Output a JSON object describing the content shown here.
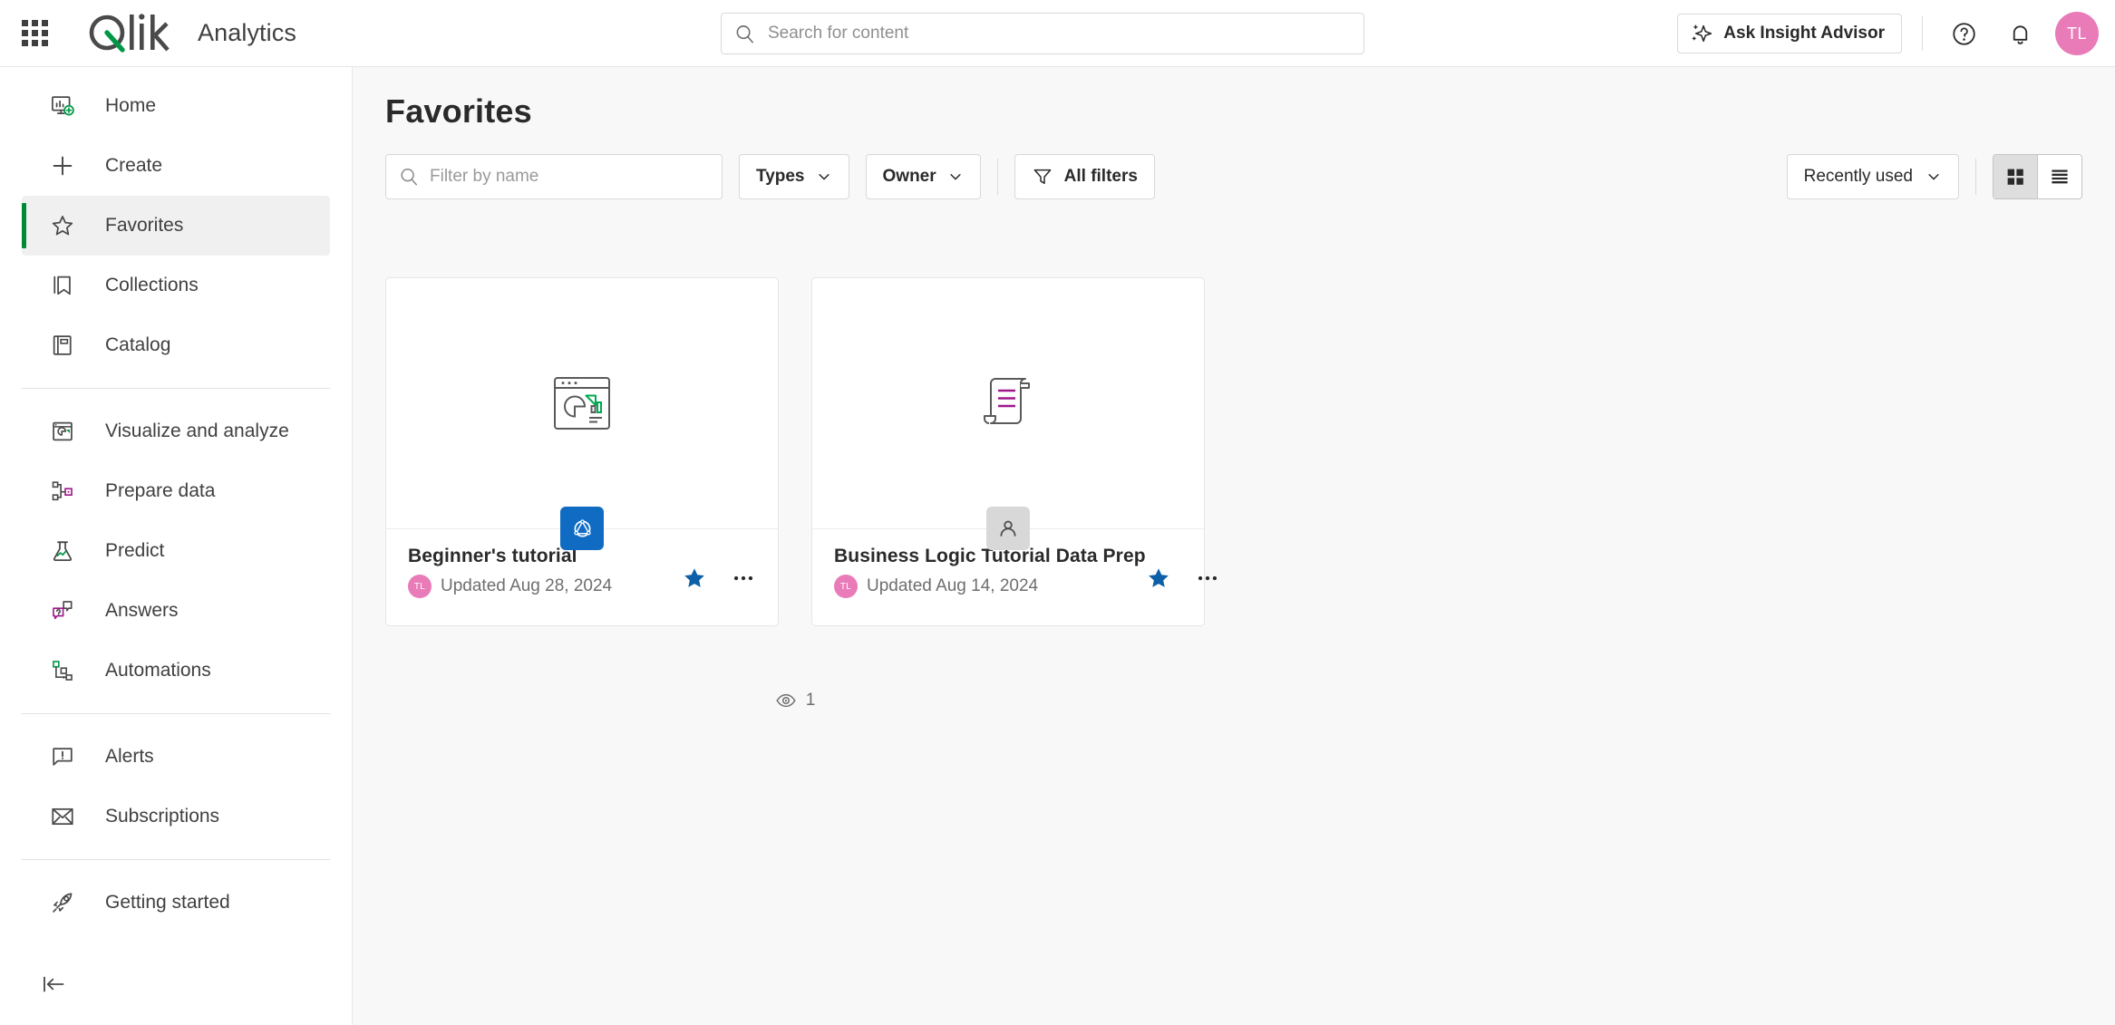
{
  "header": {
    "launcher_icon": "app-launcher-grid-icon",
    "brand": "Qlik",
    "product": "Analytics",
    "search": {
      "placeholder": "Search for content",
      "value": "",
      "icon": "search-icon"
    },
    "insight_advisor_label": "Ask Insight Advisor",
    "insight_icon": "sparkle-icon",
    "help_icon": "help-circle-icon",
    "notifications_icon": "bell-icon",
    "avatar_initials": "TL",
    "avatar_color": "#e87bb8"
  },
  "sidebar": {
    "items": [
      {
        "label": "Home",
        "icon": "home-dashboard-icon",
        "active": false
      },
      {
        "label": "Create",
        "icon": "plus-icon",
        "active": false
      },
      {
        "label": "Favorites",
        "icon": "star-outline-icon",
        "active": true
      },
      {
        "label": "Collections",
        "icon": "bookmark-icon",
        "active": false
      },
      {
        "label": "Catalog",
        "icon": "catalog-book-icon",
        "active": false
      },
      {
        "label": "Visualize and analyze",
        "icon": "chart-window-icon",
        "active": false
      },
      {
        "label": "Prepare data",
        "icon": "data-nodes-icon",
        "active": false
      },
      {
        "label": "Predict",
        "icon": "flask-icon",
        "active": false
      },
      {
        "label": "Answers",
        "icon": "chat-question-icon",
        "active": false
      },
      {
        "label": "Automations",
        "icon": "automation-flow-icon",
        "active": false
      },
      {
        "label": "Alerts",
        "icon": "alert-bubble-icon",
        "active": false
      },
      {
        "label": "Subscriptions",
        "icon": "envelope-icon",
        "active": false
      },
      {
        "label": "Getting started",
        "icon": "rocket-icon",
        "active": false
      }
    ],
    "collapse_icon": "collapse-left-icon",
    "active_indicator_color": "#008936"
  },
  "main": {
    "title": "Favorites",
    "toolbar": {
      "filter_placeholder": "Filter by name",
      "filter_value": "",
      "filter_icon": "search-icon",
      "types_label": "Types",
      "owner_label": "Owner",
      "all_filters_label": "All filters",
      "all_filters_icon": "funnel-icon",
      "chevron_icon": "chevron-down-icon",
      "sort_label": "Recently used",
      "grid_view_icon": "grid-view-icon",
      "list_view_icon": "list-view-icon",
      "active_view": "grid"
    },
    "cards": [
      {
        "name": "Beginner's tutorial",
        "date": "Updated Aug 28, 2024",
        "owner_initials": "TL",
        "thumb_icon": "chart-window-thumbnail",
        "badge_icon": "qlik-app-badge-icon",
        "badge_type": "app",
        "favorite": true,
        "favorite_icon": "star-filled-icon",
        "more_icon": "more-options-icon"
      },
      {
        "name": "Business Logic Tutorial Data Prep",
        "date": "Updated Aug 14, 2024",
        "owner_initials": "TL",
        "thumb_icon": "script-scroll-thumbnail",
        "badge_icon": "person-badge-icon",
        "badge_type": "person",
        "favorite": true,
        "favorite_icon": "star-filled-icon",
        "more_icon": "more-options-icon"
      }
    ],
    "view_count": {
      "icon": "eye-icon",
      "value": "1"
    }
  },
  "colors": {
    "qlik_green": "#009845",
    "accent_blue": "#0f6cc2",
    "accent_purple": "#a0188c",
    "page_bg": "#f8f8f8"
  }
}
